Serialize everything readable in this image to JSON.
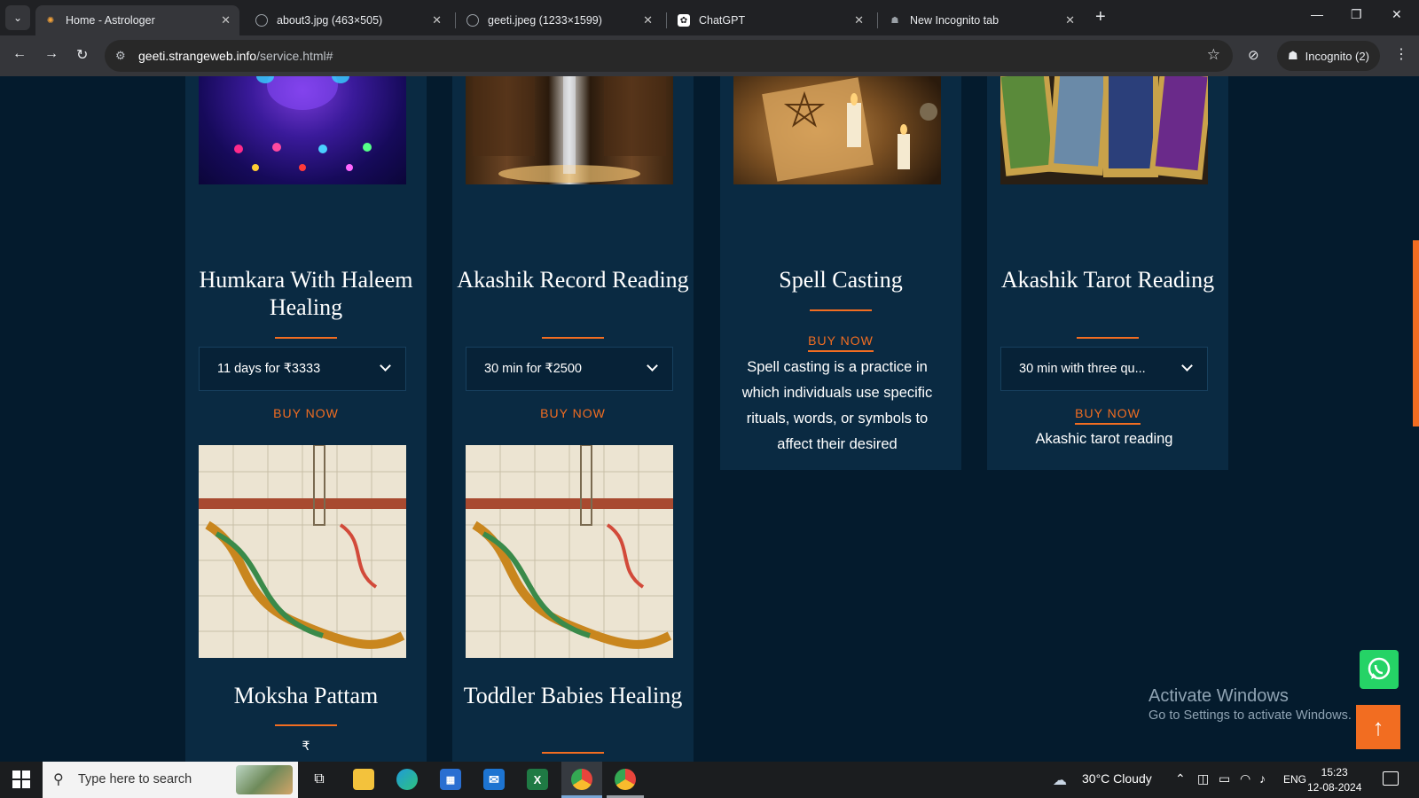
{
  "browser": {
    "tabs": [
      {
        "title": "Home - Astrologer",
        "active": true
      },
      {
        "title": "about3.jpg (463×505)",
        "active": false
      },
      {
        "title": "geeti.jpeg (1233×1599)",
        "active": false
      },
      {
        "title": "ChatGPT",
        "active": false
      },
      {
        "title": "New Incognito tab",
        "active": false
      }
    ],
    "url_host": "geeti.strangeweb.info",
    "url_path": "/service.html#",
    "incognito_label": "Incognito (2)"
  },
  "services": [
    {
      "title": "Humkara With Haleem Healing",
      "select": "11 days for ₹3333",
      "buy": "BUY NOW",
      "image": "chakra-meditation"
    },
    {
      "title": "Akashik Record Reading",
      "select": "30 min for ₹2500",
      "buy": "BUY NOW",
      "image": "library-light"
    },
    {
      "title": "Spell Casting",
      "buy": "BUY NOW",
      "description": "Spell casting is a practice in which individuals use specific rituals, words, or symbols to",
      "description_cut": "affect their desired",
      "image": "candles-pentagram"
    },
    {
      "title": "Akashik Tarot Reading",
      "select": "30 min with three qu...",
      "buy": "BUY NOW",
      "description_cut": "Akashic tarot reading",
      "image": "tarot-cards"
    },
    {
      "title": "Moksha Pattam",
      "price_symbol": "₹",
      "image": "snakes-ladders-board"
    },
    {
      "title": "Toddler Babies Healing",
      "image": "snakes-ladders-board"
    }
  ],
  "watermark": {
    "line1": "Activate Windows",
    "line2": "Go to Settings to activate Windows."
  },
  "taskbar": {
    "search_placeholder": "Type here to search",
    "weather": "30°C  Cloudy",
    "language": "ENG",
    "time": "15:23",
    "date": "12-08-2024"
  },
  "colors": {
    "accent": "#f26d21",
    "card": "#0a2a42",
    "page": "#041b2d"
  }
}
